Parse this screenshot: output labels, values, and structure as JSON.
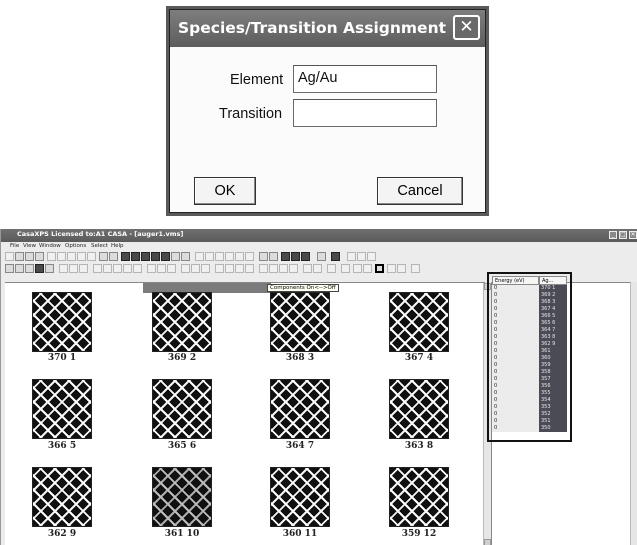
{
  "dialog": {
    "title": "Species/Transition Assignment",
    "element_label": "Element",
    "element_value": "Ag/Au",
    "transition_label": "Transition",
    "transition_value": "",
    "ok_label": "OK",
    "cancel_label": "Cancel",
    "close_glyph": "✕"
  },
  "app": {
    "title": "CasaXPS Licensed to:A1 CASA - [auger1.vms]",
    "menu": [
      "File",
      "View",
      "Window",
      "Options",
      "Select",
      "Help"
    ],
    "tooltip": "Components On<-->Off",
    "win_controls": [
      "_",
      "□",
      "✕"
    ]
  },
  "tiles": [
    {
      "label": "370 1",
      "dark": false
    },
    {
      "label": "369 2",
      "dark": false
    },
    {
      "label": "368 3",
      "dark": false
    },
    {
      "label": "367 4",
      "dark": false
    },
    {
      "label": "366 5",
      "dark": false
    },
    {
      "label": "365 6",
      "dark": false
    },
    {
      "label": "364 7",
      "dark": false
    },
    {
      "label": "363 8",
      "dark": false
    },
    {
      "label": "362 9",
      "dark": false
    },
    {
      "label": "361 10",
      "dark": true
    },
    {
      "label": "360 11",
      "dark": false
    },
    {
      "label": "359 12",
      "dark": false
    }
  ],
  "energy_table": {
    "headers": [
      "Energy (eV)",
      "Ag..."
    ],
    "rows": [
      [
        "0",
        "370 1"
      ],
      [
        "0",
        "369 2"
      ],
      [
        "0",
        "368 3"
      ],
      [
        "0",
        "367 4"
      ],
      [
        "0",
        "366 5"
      ],
      [
        "0",
        "365 6"
      ],
      [
        "0",
        "364 7"
      ],
      [
        "0",
        "363 8"
      ],
      [
        "0",
        "362 9"
      ],
      [
        "0",
        "361"
      ],
      [
        "0",
        "360"
      ],
      [
        "0",
        "359"
      ],
      [
        "0",
        "358"
      ],
      [
        "0",
        "357"
      ],
      [
        "0",
        "356"
      ],
      [
        "0",
        "355"
      ],
      [
        "0",
        "354"
      ],
      [
        "0",
        "353"
      ],
      [
        "0",
        "352"
      ],
      [
        "0",
        "351"
      ],
      [
        "0",
        "350"
      ]
    ]
  },
  "colors": {
    "titlebar": "#5d5d5d",
    "dialog_bg": "#fbfbfb",
    "app_bg": "#ececec",
    "table_selected": "#4b4b55"
  }
}
